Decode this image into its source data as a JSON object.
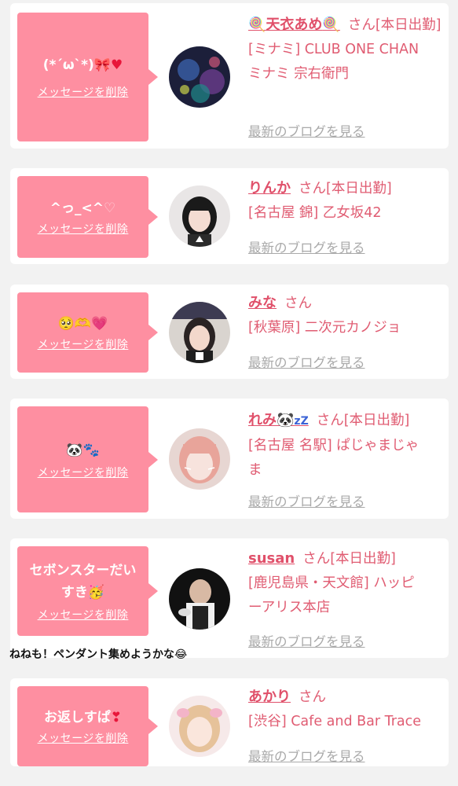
{
  "delete_label": "メッセージを削除",
  "blog_label": "最新のブログを見る",
  "san": "さん",
  "cards": [
    {
      "message": "(*´ω`*)",
      "message_suffix": "🎀♥",
      "name_prefix": "🍭",
      "name": "天衣あめ",
      "name_suffix": "🍭",
      "status": "[本日出勤]",
      "shop_line1": "[ミナミ] CLUB ONE CHAN",
      "shop_line2": "ミナミ 宗右衛門"
    },
    {
      "message": "^っ_<^",
      "message_suffix": "♡",
      "name": "りんか",
      "status": "[本日出勤]",
      "shop_line1": "[名古屋 錦] 乙女坂42"
    },
    {
      "message": "🥺🫶💗",
      "name": "みな",
      "status": "",
      "shop_line1": "[秋葉原] 二次元カノジョ"
    },
    {
      "message": "🐼🐾",
      "name": "れみ🐼",
      "name_suffix": "zZ",
      "status": "[本日出勤]",
      "shop_line1": "[名古屋 名駅] ぱじゃまじゃ",
      "shop_line2": "ま"
    },
    {
      "message_line1": "セボンスターだい",
      "message_line2": "すき🥳",
      "name": "susan",
      "status": "[本日出勤]",
      "shop_line1": "[鹿児島県・天文館] ハッピ",
      "shop_line2": "ーアリス本店"
    },
    {
      "message": "お返しすぱ",
      "message_suffix": "❣",
      "name": "あかり",
      "status": "",
      "shop_line1": "[渋谷] Cafe and Bar Trace"
    }
  ],
  "overlay_comment": "ねねも！ペンダント集めようかな😂",
  "colors": {
    "bubble": "#fe8fa1",
    "name": "#e0506a",
    "shop": "#e05c72",
    "link_gray": "#a9a9a9",
    "background": "#f2f2f2"
  }
}
